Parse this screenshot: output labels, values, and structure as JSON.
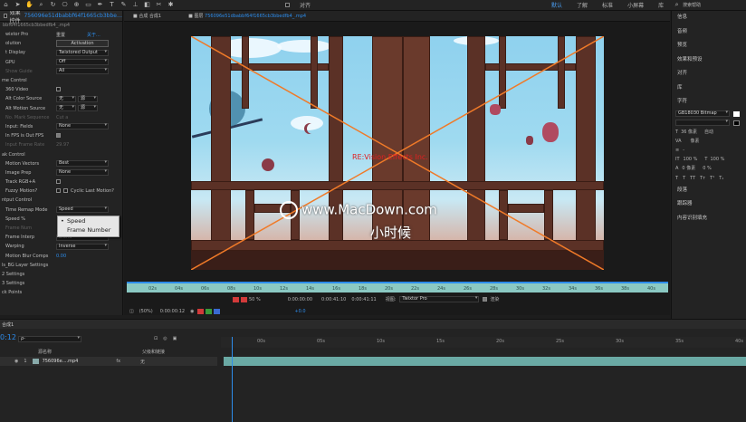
{
  "toolbar": {
    "align_label": "对齐",
    "workspaces": [
      "默认",
      "了解",
      "标准",
      "小屏幕",
      "库"
    ],
    "search_placeholder": "搜索帮助"
  },
  "effects_panel": {
    "tab_label": "效果控件",
    "tab_file": "756096e51dbabbf64f1665cb3bbe…",
    "subtitle": "bbf64f1665cb3bbedfb4_.mp4",
    "rows": [
      {
        "label": "wixtor Pro",
        "value": "重置",
        "extra": "关于..."
      },
      {
        "label": "olution",
        "value": "Activation",
        "type": "button"
      },
      {
        "label": "t Display",
        "value": "Twixtored Output",
        "type": "dropdown"
      },
      {
        "label": "GPU",
        "value": "Off",
        "type": "dropdown"
      },
      {
        "label": "Show Guide",
        "value": "All",
        "dim": true,
        "type": "dropdown"
      },
      {
        "label": "me Control",
        "section": true
      },
      {
        "label": "360 Video",
        "type": "check"
      },
      {
        "label": "Alt Color Source",
        "value": "无",
        "value2": "源",
        "type": "dd2"
      },
      {
        "label": "Alt Motion Source",
        "value": "无",
        "value2": "源",
        "type": "dd2"
      },
      {
        "label": "No. Mark Sequence",
        "value": "Cut a",
        "dim": true
      },
      {
        "label": "Input: Fields",
        "value": "None",
        "type": "dropdown"
      },
      {
        "label": "In FPS is Out FPS",
        "type": "check",
        "on": true
      },
      {
        "label": "Input Frame Rate",
        "value": "29.97",
        "dim": true
      },
      {
        "label": "ak Control",
        "section": true
      },
      {
        "label": "Motion Vectors",
        "value": "Best",
        "type": "dropdown"
      },
      {
        "label": "Image Prep",
        "value": "None",
        "type": "dropdown"
      },
      {
        "label": "Track RGB+A",
        "type": "check"
      },
      {
        "label": "Fuzzy Motion?",
        "value": "Cyclic Last Motion?",
        "type": "check2"
      },
      {
        "label": "ntput Control",
        "section": true
      },
      {
        "label": "Time Remap Mode",
        "value": "Speed",
        "type": "dropdown"
      },
      {
        "label": "Speed %",
        "value": "",
        "type": "blank"
      },
      {
        "label": "Frame Num",
        "value": "",
        "dim": true
      },
      {
        "label": "Frame Interp",
        "value": "Blend",
        "type": "dropdown"
      },
      {
        "label": "Warping",
        "value": "Inverse",
        "type": "dropdown"
      },
      {
        "label": "Motion Blur Comps",
        "value": "0.00",
        "blue": true
      },
      {
        "label": "ls_BG Layer Settings",
        "section": true
      },
      {
        "label": "2 Settings",
        "section": true
      },
      {
        "label": "3 Settings",
        "section": true
      },
      {
        "label": "ck Points",
        "section": true
      }
    ],
    "popup_options": [
      "Speed",
      "Frame Number"
    ],
    "popup_selected": "Speed"
  },
  "viewer": {
    "tab_comp": "合成 合成1",
    "tab_layer_prefix": "图层",
    "tab_layer_file": "756096e51dbabbf64f1665cb3bbedfb4_.mp4",
    "watermark": "www.MacDown.com",
    "subtitle": "小时候",
    "red_text": "RE:Vision Effects Inc.",
    "zoom": "(50%)",
    "timecode": "0:00:00:12",
    "ctrl_percent": "50 %",
    "time_in": "0:00:00:00",
    "time_dur": "0:00:41:10",
    "time_out": "0:00:41:11",
    "view_label": "视图:",
    "view_value": "Twixtor Pro",
    "render_label": "渲染",
    "offset": "+0.0"
  },
  "ruler_labels": [
    "02s",
    "04s",
    "06s",
    "08s",
    "10s",
    "12s",
    "14s",
    "16s",
    "18s",
    "20s",
    "22s",
    "24s",
    "26s",
    "28s",
    "30s",
    "32s",
    "34s",
    "36s",
    "38s",
    "40s"
  ],
  "right_panel": {
    "items": [
      "信息",
      "音频",
      "预览",
      "效果和预设",
      "对齐",
      "库",
      "字符"
    ],
    "font_name": "GB18030 Bitmap",
    "font_size": "36 像素",
    "leading": "自动",
    "tracking": "像素",
    "scale_v": "100 %",
    "scale_h": "100 %",
    "baseline": "0 像素",
    "tsume": "0 %",
    "items_bottom": [
      "段落",
      "跟踪器",
      "内容识别填充"
    ]
  },
  "timeline": {
    "comp_label": "合成1",
    "timecode": "0:12",
    "search_placeholder": "ρ-",
    "col_source": "源名称",
    "col_parent": "父级和链接",
    "layer_index": "1",
    "layer_name": "756096e....mp4",
    "layer_parent": "无",
    "ruler_labels": [
      "00s",
      "05s",
      "10s",
      "15s",
      "20s",
      "25s",
      "30s",
      "35s",
      "40s"
    ]
  }
}
